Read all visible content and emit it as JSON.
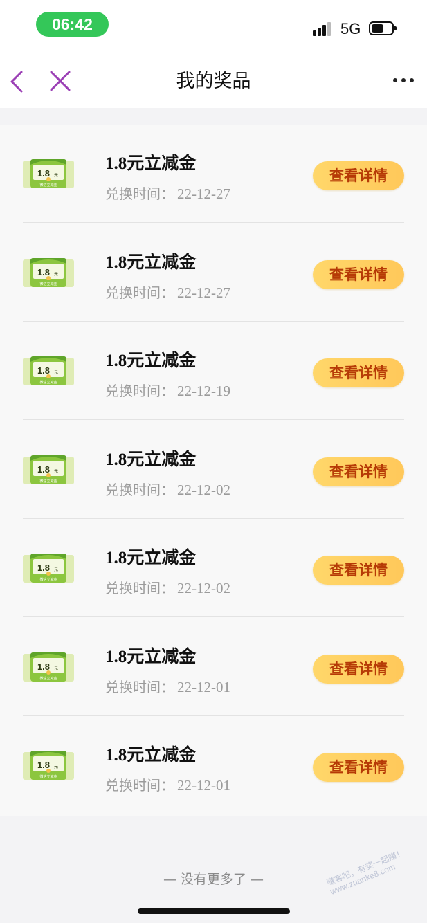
{
  "status_bar": {
    "time": "06:42",
    "network": "5G"
  },
  "nav": {
    "title": "我的奖品"
  },
  "prize": {
    "thumb_amount": "1.8",
    "thumb_unit": "元",
    "thumb_caption": "微信立减金"
  },
  "items": [
    {
      "name": "1.8元立减金",
      "date_label": "兑换时间：",
      "date": "22-12-27",
      "button": "查看详情"
    },
    {
      "name": "1.8元立减金",
      "date_label": "兑换时间：",
      "date": "22-12-27",
      "button": "查看详情"
    },
    {
      "name": "1.8元立减金",
      "date_label": "兑换时间：",
      "date": "22-12-19",
      "button": "查看详情"
    },
    {
      "name": "1.8元立减金",
      "date_label": "兑换时间：",
      "date": "22-12-02",
      "button": "查看详情"
    },
    {
      "name": "1.8元立减金",
      "date_label": "兑换时间：",
      "date": "22-12-02",
      "button": "查看详情"
    },
    {
      "name": "1.8元立减金",
      "date_label": "兑换时间：",
      "date": "22-12-01",
      "button": "查看详情"
    },
    {
      "name": "1.8元立减金",
      "date_label": "兑换时间：",
      "date": "22-12-01",
      "button": "查看详情"
    }
  ],
  "footer": {
    "end_note": "— 没有更多了 —"
  },
  "watermark": {
    "line1": "赚客吧，有奖一起赚！",
    "line2": "www.zuanke8.com"
  },
  "icons": {
    "back": "chevron-left-icon",
    "close": "close-icon",
    "more": "more-dots-icon",
    "signal": "signal-icon",
    "battery": "battery-icon"
  },
  "colors": {
    "accent_purple": "#9b3fb5",
    "button_bg": "#ffd36a",
    "button_text": "#b63a06",
    "time_pill": "#34c759"
  }
}
